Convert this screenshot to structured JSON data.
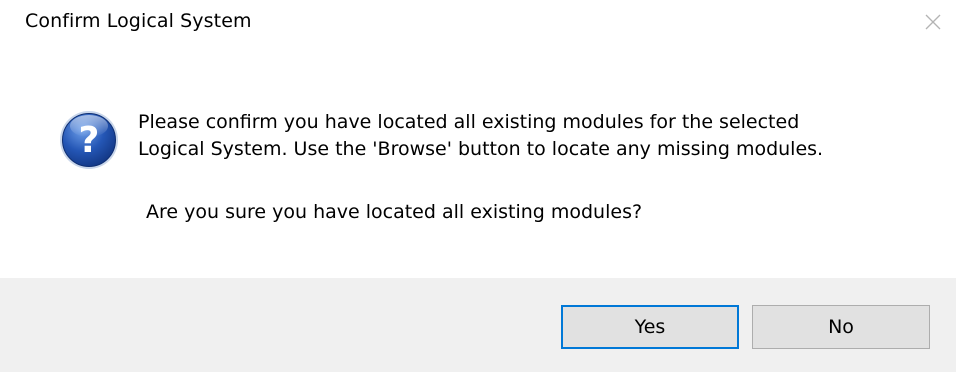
{
  "window": {
    "title": "Confirm Logical System",
    "close_icon": "close-icon"
  },
  "dialog": {
    "icon": "question-icon",
    "message_lines": [
      "Please confirm you have located all existing modules for the selected",
      "Logical System. Use the 'Browse' button to locate any missing modules."
    ],
    "question": "Are you sure you have located all existing modules?"
  },
  "buttons": {
    "yes_label": "Yes",
    "no_label": "No"
  },
  "colors": {
    "footer_background": "#f0f0f0",
    "button_face": "#e1e1e1",
    "default_button_border": "#0078d7",
    "icon_blue": "#1e4fa8"
  }
}
